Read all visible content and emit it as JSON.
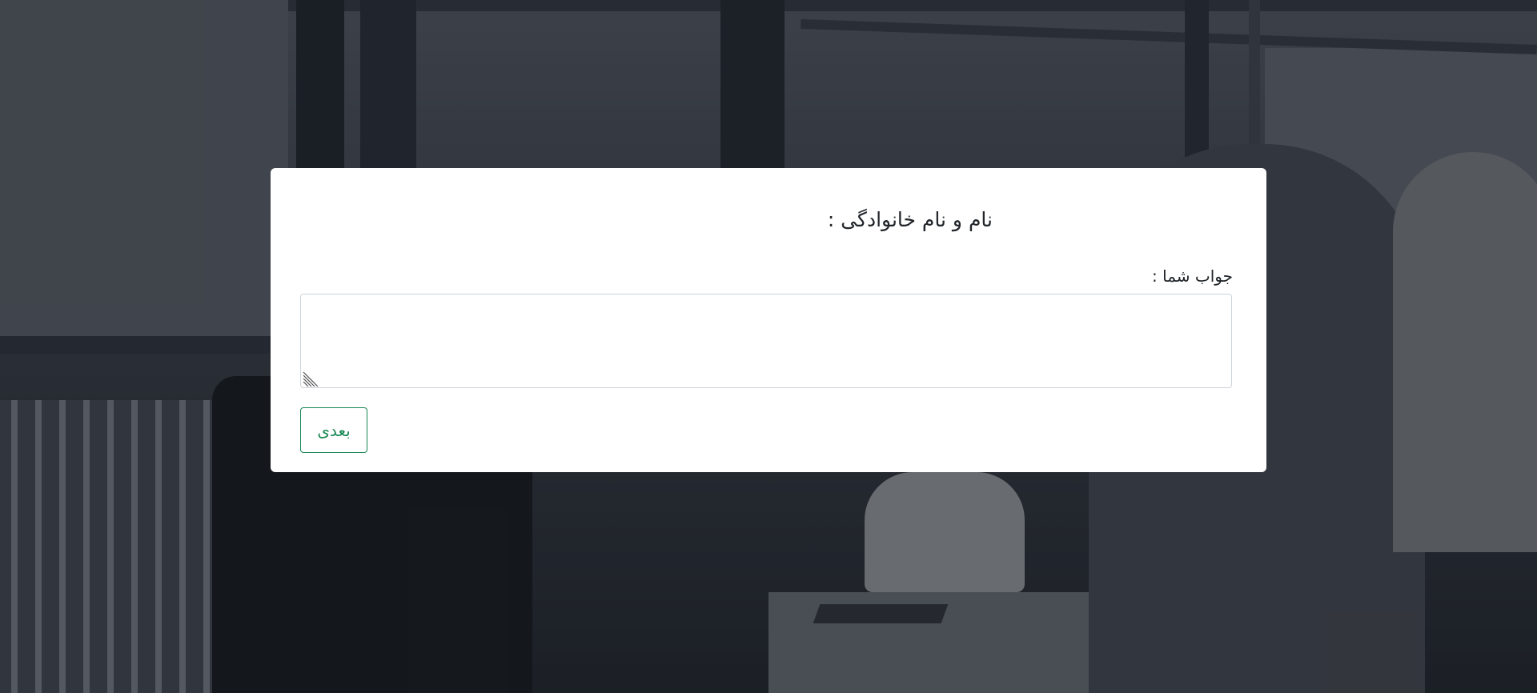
{
  "question": {
    "title": "نام و نام خانوادگی :"
  },
  "answer": {
    "label": "جواب شما :",
    "value": "",
    "placeholder": ""
  },
  "buttons": {
    "next_label": "بعدی"
  },
  "colors": {
    "accent": "#198754",
    "card_background": "#ffffff",
    "text": "#212529",
    "input_border": "#ced4da"
  },
  "icons": {
    "resize_handle": "resize-grip-icon"
  }
}
